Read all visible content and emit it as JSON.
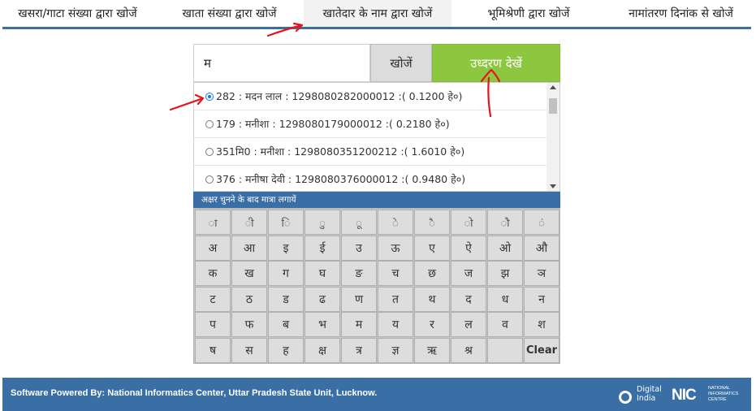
{
  "tabs": [
    {
      "label": "खसरा/गाटा संख्या द्वारा खोजें",
      "active": false
    },
    {
      "label": "खाता संख्या द्वारा खोजें",
      "active": false
    },
    {
      "label": "खातेदार के नाम द्वारा खोजें",
      "active": true
    },
    {
      "label": "भूमिश्रेणी द्वारा खोजें",
      "active": false
    },
    {
      "label": "नामांतरण दिनांक से खोजें",
      "active": false
    }
  ],
  "search": {
    "value": "म",
    "search_button": "खोजें",
    "extract_button": "उध्दरण देखें"
  },
  "results": [
    {
      "text": "282 : मदन लाल : 1298080282000012 :( 0.1200 हे०)",
      "selected": true
    },
    {
      "text": "179 : मनीशा : 1298080179000012 :( 0.2180 हे०)",
      "selected": false
    },
    {
      "text": "351मि0 : मनीशा : 1298080351200212 :( 1.6010 हे०)",
      "selected": false
    },
    {
      "text": "376 : मनीषा देवी : 1298080376000012 :( 0.9480 हे०)",
      "selected": false
    }
  ],
  "keyboard": {
    "header": "अक्षर चुनने के बाद मात्रा लगायें",
    "rows": [
      [
        "ा",
        "ी",
        "ि",
        "ु",
        "ू",
        "े",
        "ै",
        "ो",
        "ौ",
        "ं"
      ],
      [
        "अ",
        "आ",
        "इ",
        "ई",
        "उ",
        "ऊ",
        "ए",
        "ऐ",
        "ओ",
        "औ"
      ],
      [
        "क",
        "ख",
        "ग",
        "घ",
        "ङ",
        "च",
        "छ",
        "ज",
        "झ",
        "ञ"
      ],
      [
        "ट",
        "ठ",
        "ड",
        "ढ",
        "ण",
        "त",
        "थ",
        "द",
        "ध",
        "न"
      ],
      [
        "प",
        "फ",
        "ब",
        "भ",
        "म",
        "य",
        "र",
        "ल",
        "व",
        "श"
      ],
      [
        "ष",
        "स",
        "ह",
        "क्ष",
        "त्र",
        "ज्ञ",
        "ऋ",
        "श्र",
        "",
        "Clear"
      ]
    ]
  },
  "footer": {
    "text": "Software Powered By: National Informatics Center, Uttar Pradesh State Unit, Lucknow.",
    "digital_india": "Digital\nIndia",
    "nic_mark": "NIC",
    "nic_sub": "NATIONAL\nINFORMATICS\nCENTRE"
  },
  "colors": {
    "accent": "#3a6fa6",
    "extract_button": "#8dc63f",
    "annotation": "#e4141c"
  }
}
